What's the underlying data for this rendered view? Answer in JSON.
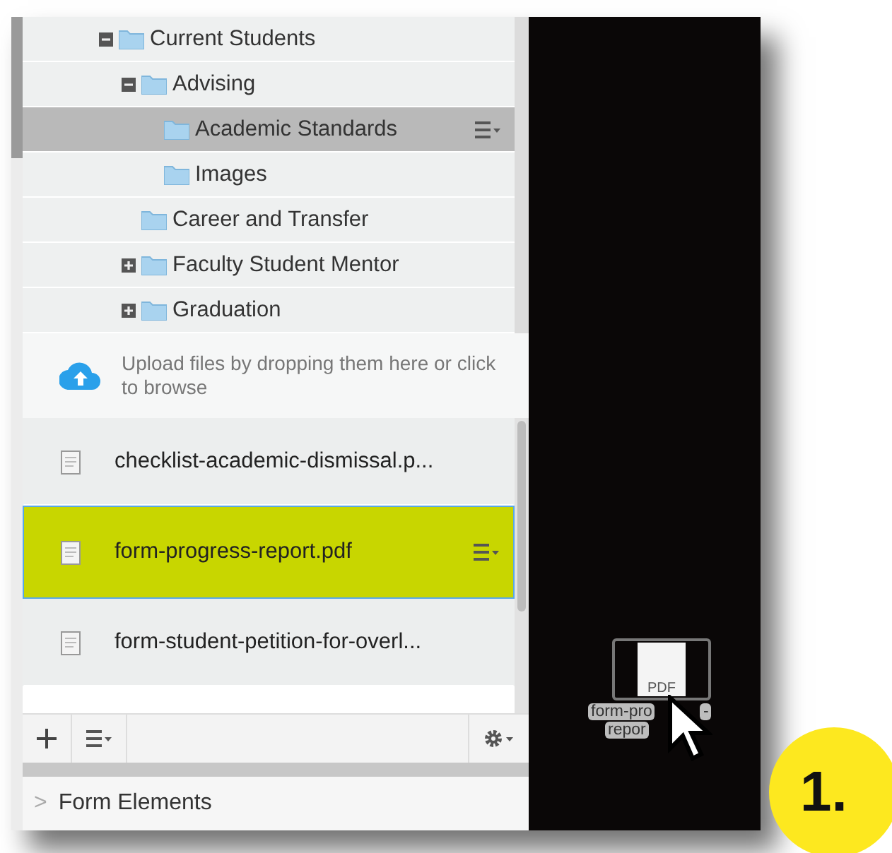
{
  "tree": [
    {
      "label": "Current Students",
      "expanded": true,
      "selected": false,
      "children": [
        {
          "label": "Advising",
          "expanded": true,
          "selected": false,
          "children": [
            {
              "label": "Academic Standards",
              "selected": true
            },
            {
              "label": "Images",
              "selected": false
            }
          ]
        },
        {
          "label": "Career and Transfer",
          "selected": false
        },
        {
          "label": "Faculty Student Mentor",
          "expanded": false,
          "selected": false
        },
        {
          "label": "Graduation",
          "expanded": false,
          "selected": false
        }
      ]
    }
  ],
  "upload": {
    "text": "Upload files by dropping them here or click to browse"
  },
  "files": [
    {
      "name": "checklist-academic-dismissal.p...",
      "selected": false
    },
    {
      "name": "form-progress-report.pdf",
      "selected": true
    },
    {
      "name": "form-student-petition-for-overl...",
      "selected": false
    }
  ],
  "section": {
    "label": "Form Elements",
    "arrow": ">"
  },
  "drag": {
    "badge": "PDF",
    "label_parts": [
      "form-pro",
      "-",
      "repor"
    ]
  },
  "step": {
    "label": "1."
  }
}
